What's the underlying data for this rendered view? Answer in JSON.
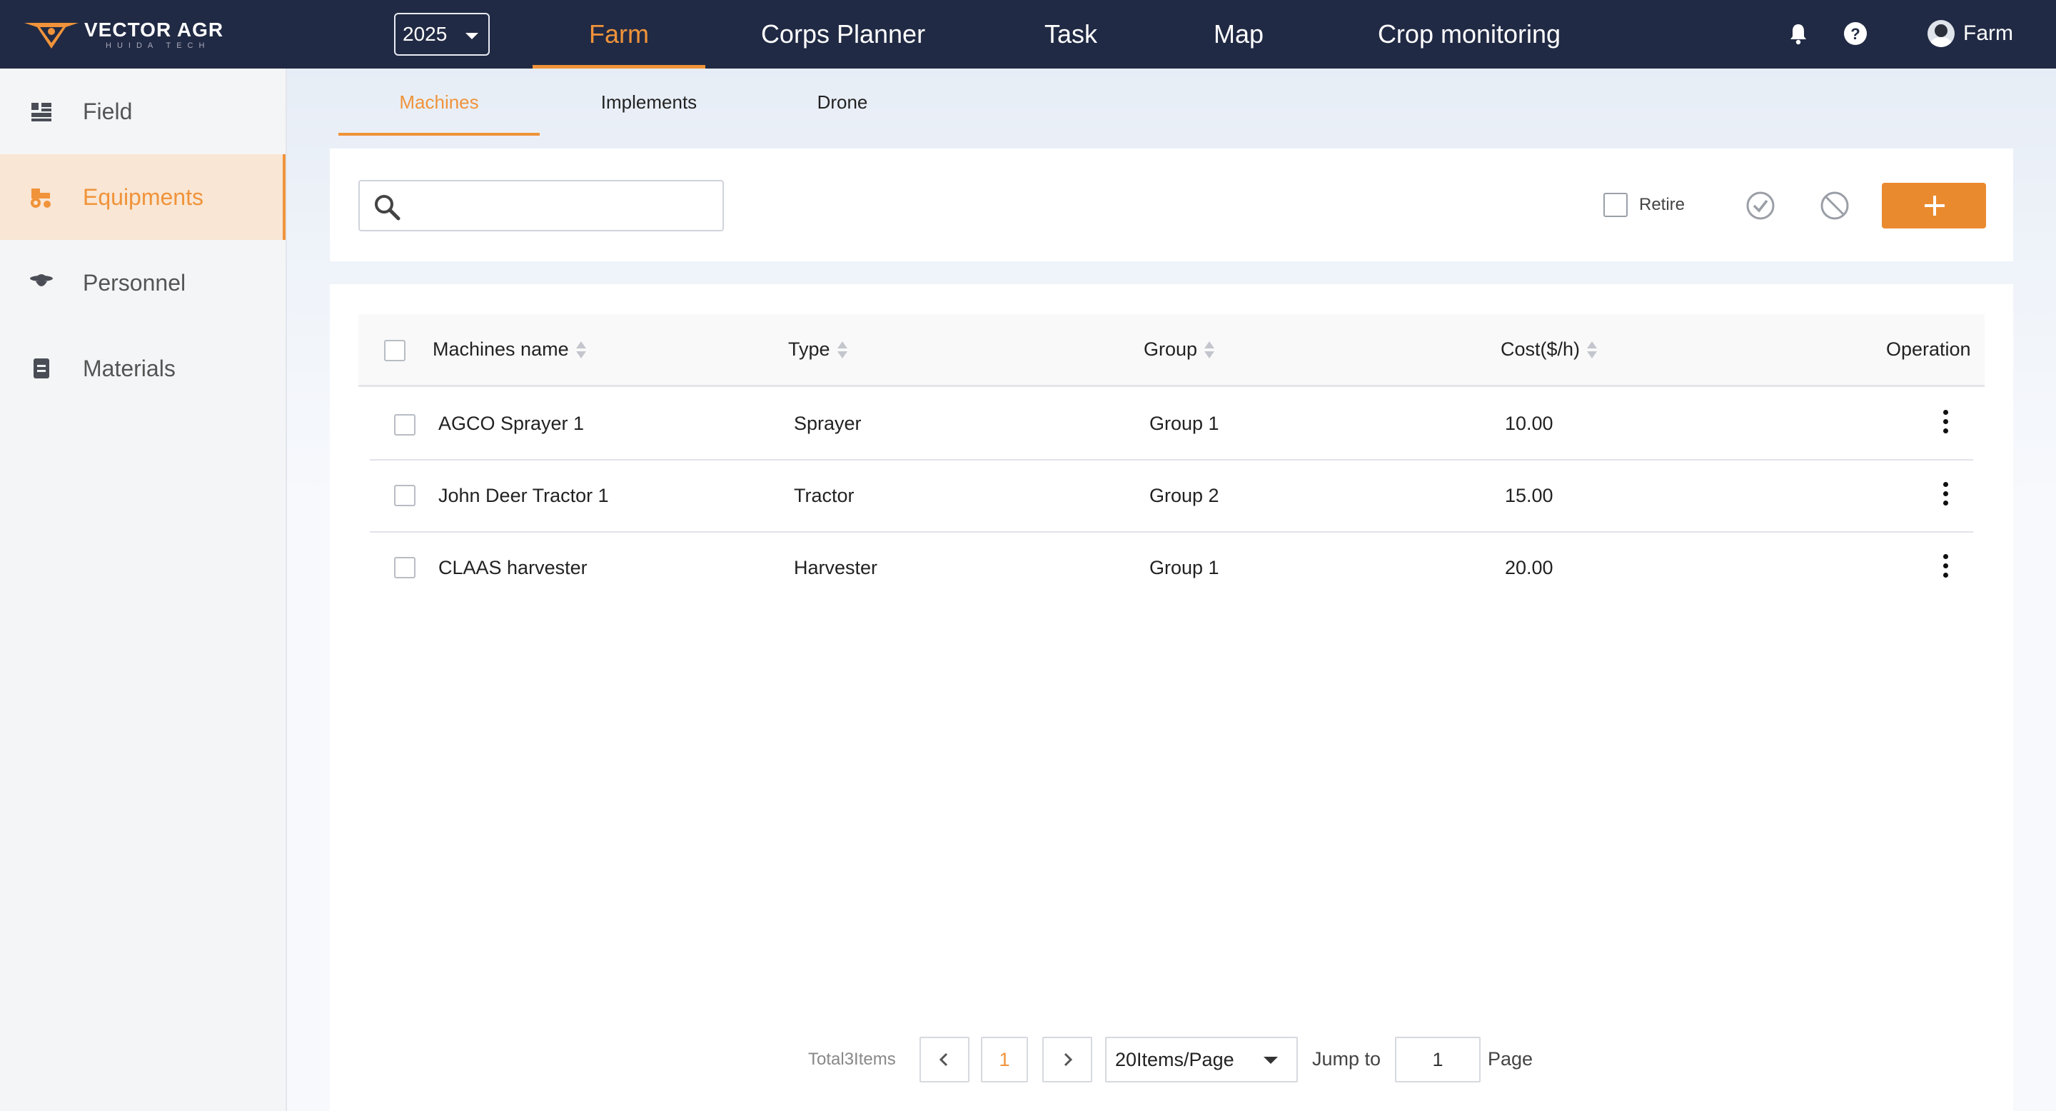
{
  "brand": {
    "name": "VECTOR AGR",
    "tagline": "HUIDA TECH"
  },
  "header": {
    "year": "2025",
    "nav": [
      {
        "label": "Farm",
        "active": true
      },
      {
        "label": "Corps Planner"
      },
      {
        "label": "Task"
      },
      {
        "label": "Map"
      },
      {
        "label": "Crop monitoring"
      }
    ],
    "icons": [
      "bell-icon",
      "help-icon"
    ],
    "user": "Farm"
  },
  "sidebar": {
    "items": [
      {
        "label": "Field",
        "icon": "field-icon"
      },
      {
        "label": "Equipments",
        "icon": "tractor-icon",
        "active": true
      },
      {
        "label": "Personnel",
        "icon": "farmer-icon"
      },
      {
        "label": "Materials",
        "icon": "clipboard-icon"
      }
    ]
  },
  "subtabs": [
    {
      "label": "Machines",
      "active": true
    },
    {
      "label": "Implements"
    },
    {
      "label": "Drone"
    }
  ],
  "toolbar": {
    "search_placeholder": "",
    "retire_label": "Retire",
    "accent": "#ea8a2f"
  },
  "table": {
    "headers": {
      "name": "Machines name",
      "type": "Type",
      "group": "Group",
      "cost": "Cost($/h)",
      "operation": "Operation"
    },
    "rows": [
      {
        "name": "AGCO Sprayer 1",
        "type": "Sprayer",
        "group": "Group 1",
        "cost": "10.00"
      },
      {
        "name": "John Deer Tractor 1",
        "type": "Tractor",
        "group": "Group 2",
        "cost": "15.00"
      },
      {
        "name": "CLAAS harvester",
        "type": "Harvester",
        "group": "Group 1",
        "cost": "20.00"
      }
    ]
  },
  "pagination": {
    "total": "Total3Items",
    "current_page": "1",
    "page_size": "20Items/Page",
    "jump_label": "Jump to",
    "jump_value": "1",
    "page_label": "Page"
  }
}
